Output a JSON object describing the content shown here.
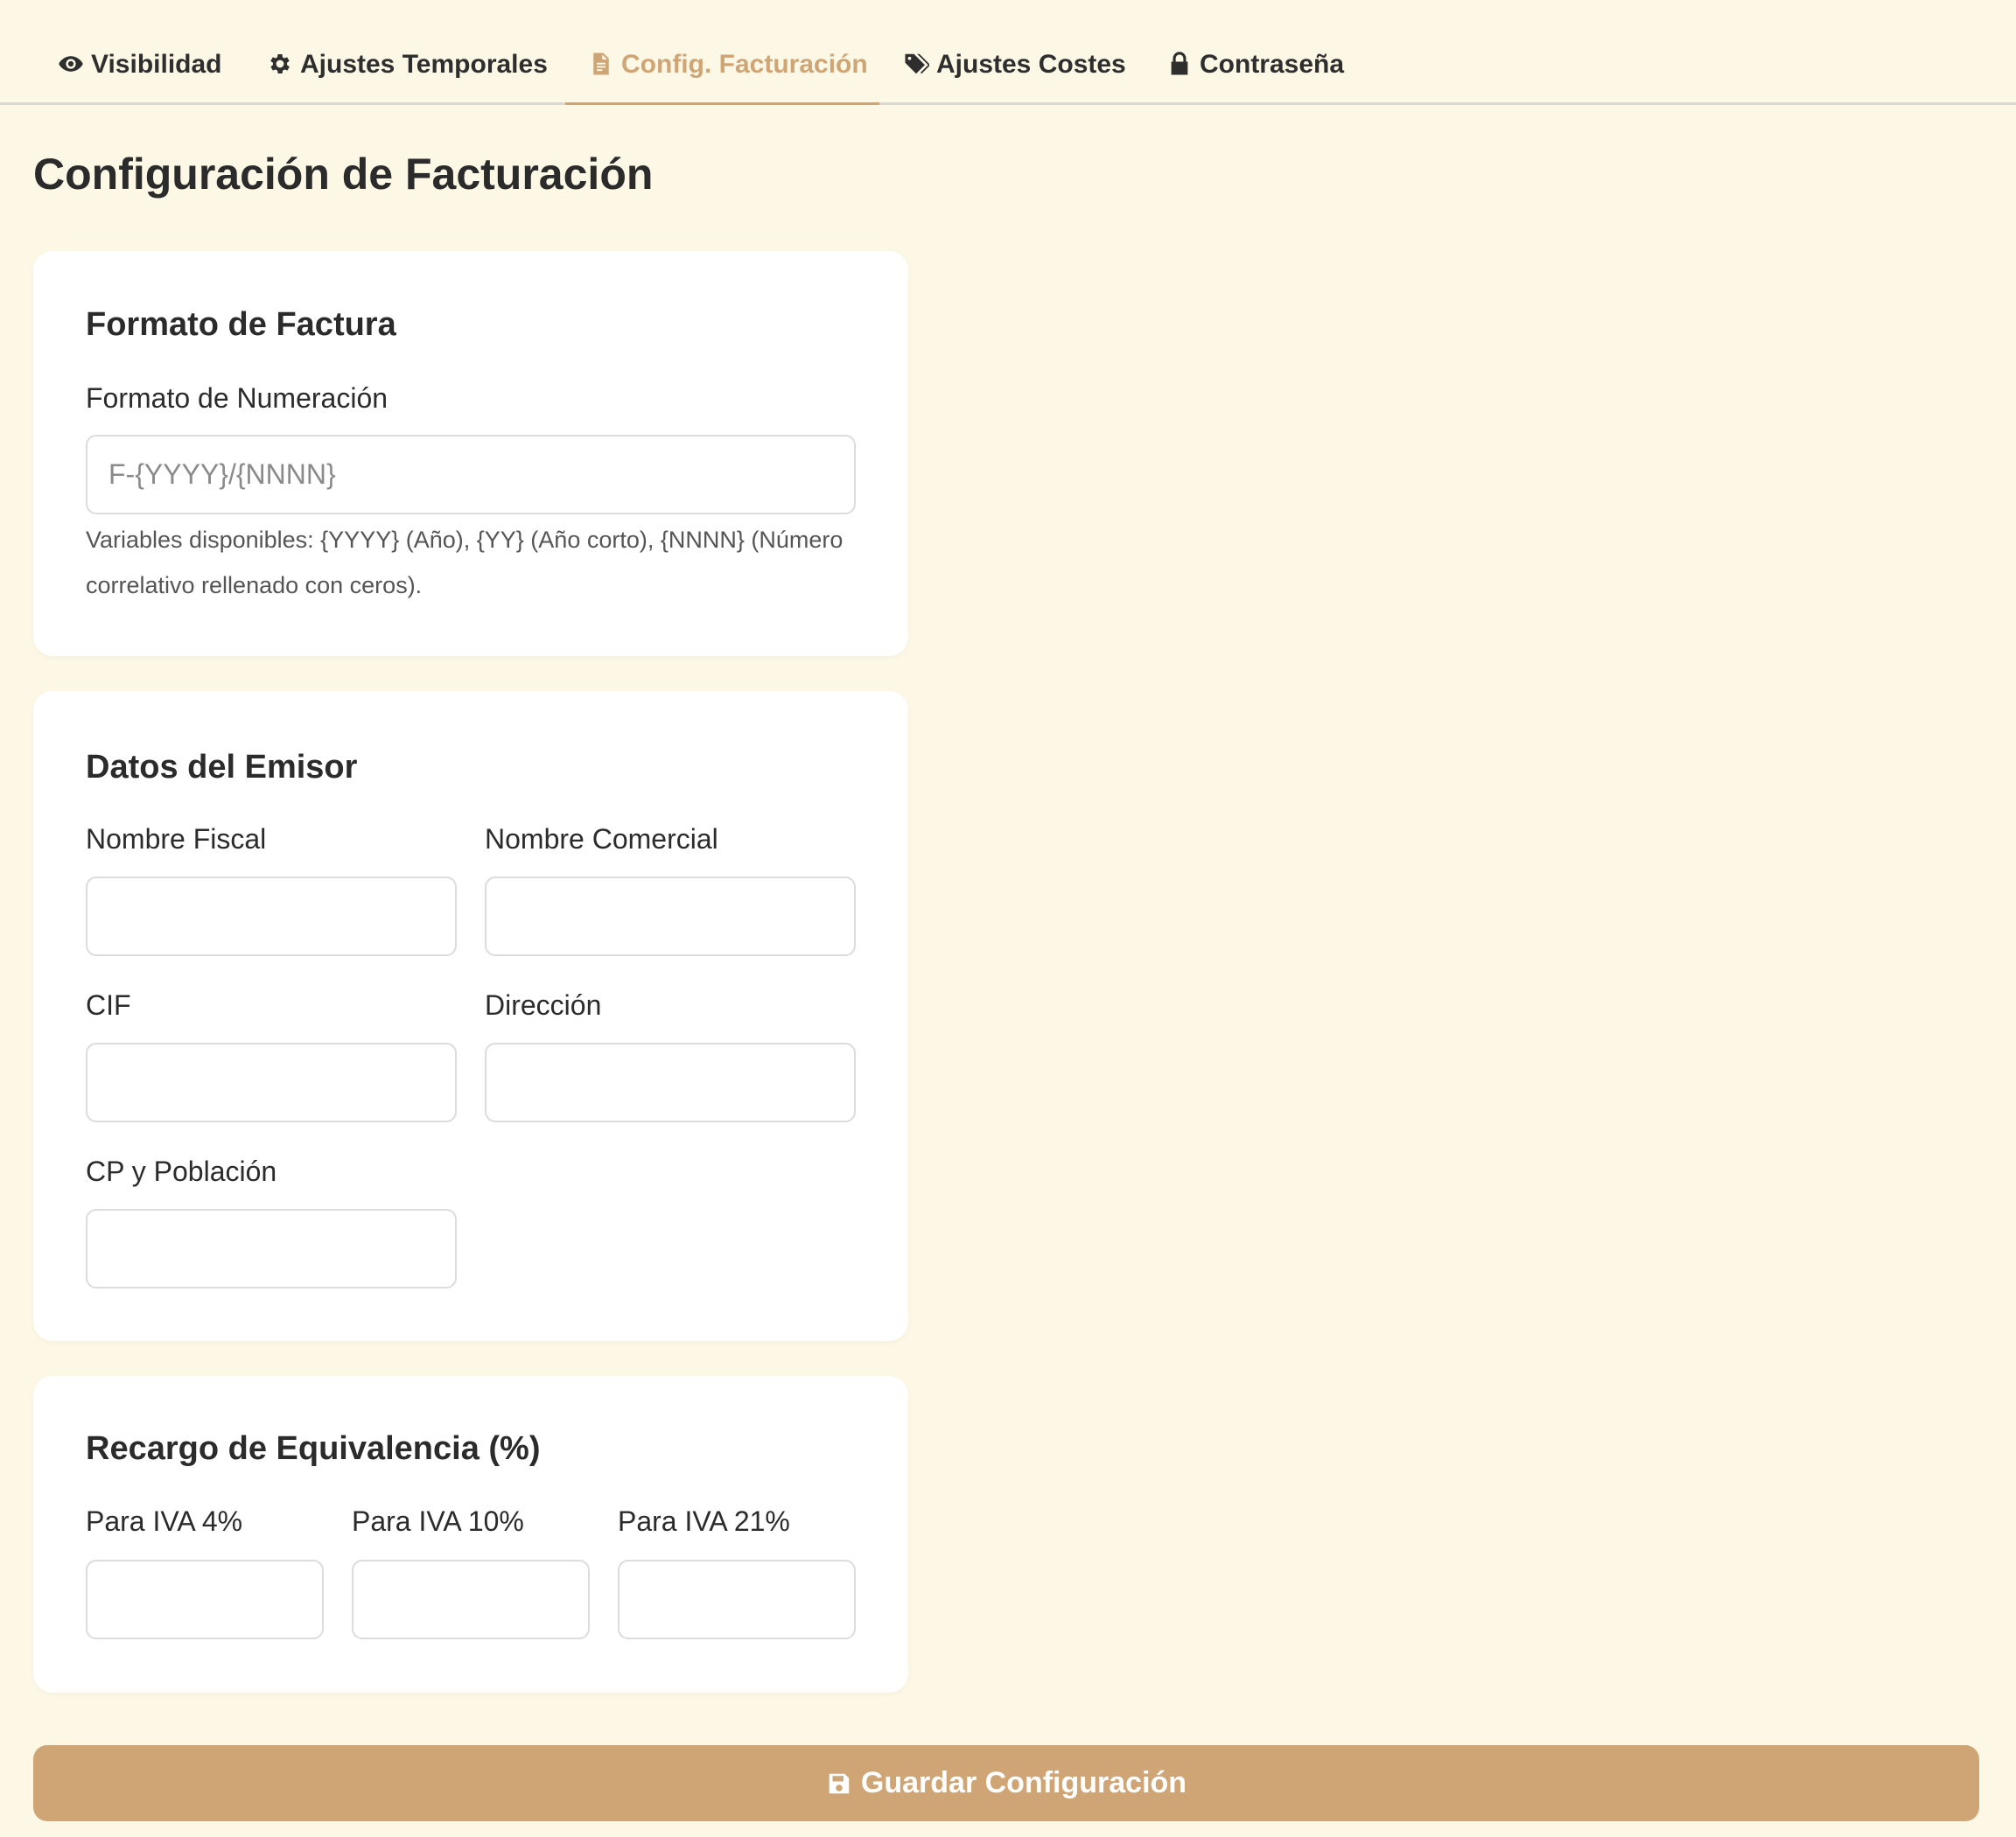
{
  "tabs": [
    {
      "label": "Visibilidad",
      "icon": "eye-icon",
      "active": false
    },
    {
      "label": "Ajustes Temporales",
      "icon": "gear-icon",
      "active": false
    },
    {
      "label": "Config. Facturación",
      "icon": "file-invoice-icon",
      "active": true
    },
    {
      "label": "Ajustes Costes",
      "icon": "tags-icon",
      "active": false
    },
    {
      "label": "Contraseña",
      "icon": "lock-icon",
      "active": false
    }
  ],
  "page_title": "Configuración de Facturación",
  "formato": {
    "title": "Formato de Factura",
    "numeracion_label": "Formato de Numeración",
    "numeracion_value": "",
    "numeracion_placeholder": "F-{YYYY}/{NNNN}",
    "help": "Variables disponibles: {YYYY} (Año), {YY} (Año corto), {NNNN} (Número correlativo rellenado con ceros)."
  },
  "emisor": {
    "title": "Datos del Emisor",
    "nombre_fiscal_label": "Nombre Fiscal",
    "nombre_fiscal_value": "",
    "nombre_comercial_label": "Nombre Comercial",
    "nombre_comercial_value": "",
    "cif_label": "CIF",
    "cif_value": "",
    "direccion_label": "Dirección",
    "direccion_value": "",
    "cp_label": "CP y Población",
    "cp_value": ""
  },
  "recargo": {
    "title": "Recargo de Equivalencia (%)",
    "iva4_label": "Para IVA 4%",
    "iva4_value": "",
    "iva10_label": "Para IVA 10%",
    "iva10_value": "",
    "iva21_label": "Para IVA 21%",
    "iva21_value": ""
  },
  "save_button": {
    "label": "Guardar Configuración",
    "icon": "floppy-disk-icon"
  },
  "colors": {
    "accent": "#cfa576",
    "background": "#fdf8e6",
    "card": "#ffffff",
    "text": "#2b2b2b"
  }
}
